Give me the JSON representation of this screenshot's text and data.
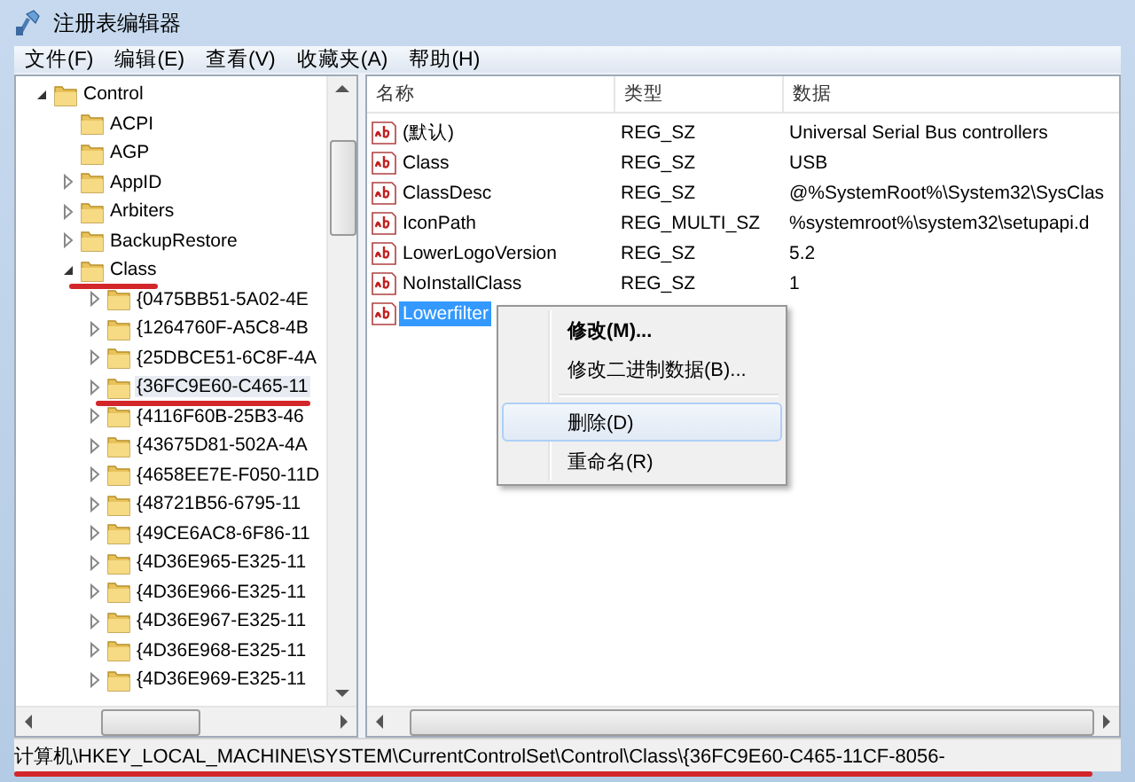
{
  "window": {
    "title": "注册表编辑器"
  },
  "menu": [
    "文件(F)",
    "编辑(E)",
    "查看(V)",
    "收藏夹(A)",
    "帮助(H)"
  ],
  "tree": [
    {
      "label": "Control",
      "kind": "branch",
      "expanded": true,
      "selected": false,
      "underlined": false,
      "children": [
        {
          "label": "ACPI",
          "kind": "leaf",
          "selected": false,
          "underlined": false
        },
        {
          "label": "AGP",
          "kind": "leaf",
          "selected": false,
          "underlined": false
        },
        {
          "label": "AppID",
          "kind": "branch",
          "expanded": false,
          "selected": false,
          "underlined": false
        },
        {
          "label": "Arbiters",
          "kind": "branch",
          "expanded": false,
          "selected": false,
          "underlined": false
        },
        {
          "label": "BackupRestore",
          "kind": "branch",
          "expanded": false,
          "selected": false,
          "underlined": false
        },
        {
          "label": "Class",
          "kind": "branch",
          "expanded": true,
          "selected": false,
          "underlined": true,
          "children": [
            {
              "label": "{0475BB51-5A02-4E",
              "kind": "branch",
              "expanded": false,
              "selected": false,
              "underlined": false
            },
            {
              "label": "{1264760F-A5C8-4B",
              "kind": "branch",
              "expanded": false,
              "selected": false,
              "underlined": false
            },
            {
              "label": "{25DBCE51-6C8F-4A",
              "kind": "branch",
              "expanded": false,
              "selected": false,
              "underlined": false
            },
            {
              "label": "{36FC9E60-C465-11",
              "kind": "branch",
              "expanded": false,
              "selected": true,
              "underlined": true
            },
            {
              "label": "{4116F60B-25B3-46",
              "kind": "branch",
              "expanded": false,
              "selected": false,
              "underlined": false
            },
            {
              "label": "{43675D81-502A-4A",
              "kind": "branch",
              "expanded": false,
              "selected": false,
              "underlined": false
            },
            {
              "label": "{4658EE7E-F050-11D",
              "kind": "branch",
              "expanded": false,
              "selected": false,
              "underlined": false
            },
            {
              "label": "{48721B56-6795-11",
              "kind": "branch",
              "expanded": false,
              "selected": false,
              "underlined": false
            },
            {
              "label": "{49CE6AC8-6F86-11",
              "kind": "branch",
              "expanded": false,
              "selected": false,
              "underlined": false
            },
            {
              "label": "{4D36E965-E325-11",
              "kind": "branch",
              "expanded": false,
              "selected": false,
              "underlined": false
            },
            {
              "label": "{4D36E966-E325-11",
              "kind": "branch",
              "expanded": false,
              "selected": false,
              "underlined": false
            },
            {
              "label": "{4D36E967-E325-11",
              "kind": "branch",
              "expanded": false,
              "selected": false,
              "underlined": false
            },
            {
              "label": "{4D36E968-E325-11",
              "kind": "branch",
              "expanded": false,
              "selected": false,
              "underlined": false
            },
            {
              "label": "{4D36E969-E325-11",
              "kind": "branch",
              "expanded": false,
              "selected": false,
              "underlined": false
            }
          ]
        }
      ]
    }
  ],
  "values": {
    "columns": [
      "名称",
      "类型",
      "数据"
    ],
    "rows": [
      {
        "name": "(默认)",
        "type": "REG_SZ",
        "data": "Universal Serial Bus controllers",
        "selected": false
      },
      {
        "name": "Class",
        "type": "REG_SZ",
        "data": "USB",
        "selected": false
      },
      {
        "name": "ClassDesc",
        "type": "REG_SZ",
        "data": "@%SystemRoot%\\System32\\SysClas",
        "selected": false
      },
      {
        "name": "IconPath",
        "type": "REG_MULTI_SZ",
        "data": "%systemroot%\\system32\\setupapi.d",
        "selected": false
      },
      {
        "name": "LowerLogoVersion",
        "type": "REG_SZ",
        "data": "5.2",
        "selected": false
      },
      {
        "name": "NoInstallClass",
        "type": "REG_SZ",
        "data": "1",
        "selected": false
      },
      {
        "name": "Lowerfilter",
        "selected": true
      }
    ]
  },
  "context_menu": [
    {
      "kind": "item",
      "label": "修改(M)...",
      "bold": true,
      "selected": false
    },
    {
      "kind": "item",
      "label": "修改二进制数据(B)...",
      "bold": false,
      "selected": false
    },
    {
      "kind": "separator"
    },
    {
      "kind": "item",
      "label": "删除(D)",
      "bold": false,
      "selected": true
    },
    {
      "kind": "item",
      "label": "重命名(R)",
      "bold": false,
      "selected": false
    }
  ],
  "status_bar": {
    "text": "计算机\\HKEY_LOCAL_MACHINE\\SYSTEM\\CurrentControlSet\\Control\\Class\\{36FC9E60-C465-11CF-8056-",
    "underlined": true
  }
}
